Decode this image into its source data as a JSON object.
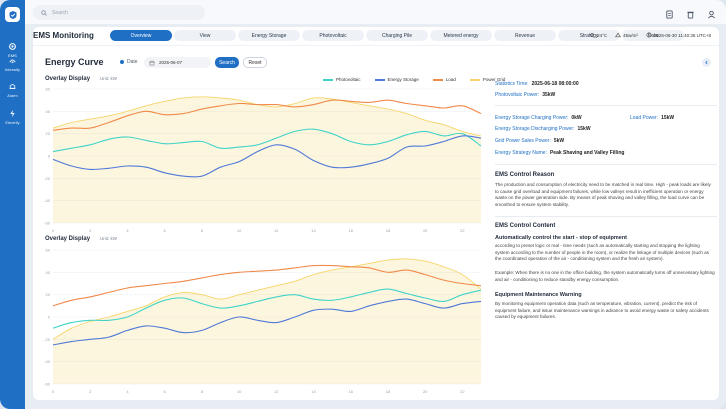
{
  "sidebar": {
    "items": [
      {
        "label": "EMS",
        "icon": "gear-icon"
      },
      {
        "label": "Intensity",
        "icon": "signal-icon"
      },
      {
        "label": "Alarm",
        "icon": "bell-icon"
      },
      {
        "label": "Electrify",
        "icon": "bolt-icon"
      }
    ]
  },
  "topbar": {
    "search_placeholder": "Search",
    "icons": [
      "document-icon",
      "trash-icon",
      "user-icon"
    ]
  },
  "header": {
    "title": "EMS Monitoring",
    "tabs": [
      {
        "label": "Overview",
        "active": true
      },
      {
        "label": "View",
        "active": false
      },
      {
        "label": "Energy Storage",
        "active": false
      },
      {
        "label": "Photovoltaic",
        "active": false
      },
      {
        "label": "Charging Pile",
        "active": false
      },
      {
        "label": "Metered energy",
        "active": false
      },
      {
        "label": "Revenue",
        "active": false
      },
      {
        "label": "Strategy",
        "active": false
      },
      {
        "label": "Data",
        "active": false
      }
    ],
    "status": {
      "temperature": "24°C",
      "power": "45w/m²",
      "datetime": "2025-06-30 11:40:35 UTC+8"
    }
  },
  "toolbar": {
    "section_title": "Energy Curve",
    "date_label": "Date",
    "date_value": "2025-06-07",
    "search_label": "Search",
    "reset_label": "Reset"
  },
  "legend": [
    {
      "name": "Photovoltaic",
      "color": "#3fd3c8"
    },
    {
      "name": "Energy Storage",
      "color": "#4f79d8"
    },
    {
      "name": "Load",
      "color": "#f08a4b"
    },
    {
      "name": "Power Grid",
      "color": "#f5d56b"
    }
  ],
  "chart_data": [
    {
      "type": "line",
      "title": "Overlay Display",
      "unit_label": "Unit: kW",
      "x": [
        "0",
        "1",
        "2",
        "3",
        "4",
        "5",
        "6",
        "7",
        "8",
        "9",
        "10",
        "11",
        "12",
        "13",
        "14",
        "15",
        "16",
        "17",
        "18",
        "19",
        "20",
        "21",
        "22",
        "23"
      ],
      "ylim": [
        -60,
        60
      ],
      "yticks": [
        60,
        40,
        20,
        0,
        -20,
        -40,
        -60
      ],
      "series": [
        {
          "name": "Power Grid",
          "type": "area",
          "values": [
            25,
            30,
            33,
            36,
            40,
            45,
            49,
            52,
            53,
            52,
            50,
            46,
            44,
            47,
            52,
            51,
            48,
            45,
            42,
            38,
            32,
            28,
            22,
            18
          ]
        },
        {
          "name": "Load",
          "values": [
            23,
            25,
            25,
            30,
            36,
            40,
            37,
            38,
            42,
            45,
            47,
            46,
            46,
            44,
            46,
            50,
            49,
            48,
            50,
            47,
            45,
            43,
            45,
            38
          ]
        },
        {
          "name": "Photovoltaic",
          "values": [
            4,
            7,
            10,
            15,
            17,
            14,
            11,
            12,
            13,
            7,
            8,
            10,
            16,
            22,
            24,
            20,
            13,
            10,
            13,
            19,
            22,
            18,
            20,
            9
          ]
        },
        {
          "name": "Energy Storage",
          "values": [
            -3,
            -9,
            -12,
            -11,
            -9,
            -10,
            -15,
            -18,
            -18,
            -10,
            -5,
            4,
            10,
            6,
            -4,
            -10,
            -10,
            -7,
            -2,
            8,
            9,
            13,
            18,
            16
          ]
        }
      ]
    },
    {
      "type": "line",
      "title": "Overlay Display",
      "unit_label": "Unit: kW",
      "x": [
        "0",
        "1",
        "2",
        "3",
        "4",
        "5",
        "6",
        "7",
        "8",
        "9",
        "10",
        "11",
        "12",
        "13",
        "14",
        "15",
        "16",
        "17",
        "18",
        "19",
        "20",
        "21",
        "22",
        "23"
      ],
      "ylim": [
        -60,
        60
      ],
      "yticks": [
        60,
        40,
        20,
        0,
        -20,
        -40,
        -60
      ],
      "series": [
        {
          "name": "Power Grid",
          "type": "area",
          "values": [
            -20,
            -10,
            -4,
            0,
            5,
            10,
            18,
            22,
            20,
            16,
            20,
            24,
            28,
            32,
            38,
            42,
            45,
            48,
            51,
            52,
            50,
            45,
            38,
            25
          ]
        },
        {
          "name": "Load",
          "values": [
            10,
            15,
            18,
            22,
            26,
            28,
            30,
            32,
            35,
            38,
            40,
            41,
            42,
            44,
            46,
            46,
            45,
            44,
            40,
            42,
            38,
            33,
            30,
            28
          ]
        },
        {
          "name": "Photovoltaic",
          "values": [
            -10,
            -5,
            -3,
            -3,
            0,
            8,
            15,
            17,
            12,
            8,
            10,
            14,
            18,
            20,
            16,
            15,
            18,
            22,
            25,
            21,
            17,
            14,
            20,
            24
          ]
        },
        {
          "name": "Energy Storage",
          "values": [
            -25,
            -22,
            -20,
            -18,
            -12,
            -8,
            -10,
            -14,
            -12,
            -5,
            0,
            -3,
            -5,
            0,
            6,
            7,
            5,
            10,
            14,
            16,
            12,
            8,
            12,
            14
          ]
        }
      ]
    }
  ],
  "panel": {
    "stats_time_label": "Statistics Time:",
    "stats_time_value": "2025-06-18 08:00:00",
    "pv_power_label": "Photovoltaic Power:",
    "pv_power_value": "35kW",
    "es_charge_label": "Energy Storage Charging Power:",
    "es_charge_value": "0kW",
    "load_power_label": "Load Power:",
    "load_power_value": "15kW",
    "es_discharge_label": "Energy Storage Discharging Power:",
    "es_discharge_value": "15kW",
    "grid_sales_label": "Grid Power Sales Power:",
    "grid_sales_value": "5kW",
    "strategy_label": "Energy Strategy Name:",
    "strategy_value": "Peak Shaving and Valley Filling",
    "reason_title": "EMS Control Reason",
    "reason_text": "The production and consumption of electricity need to be matched in real time. High - peak loads are likely to cause grid overload and equipment failures, while low valleys result in inefficient operation or energy waste on the power generation side. By means of peak shaving and valley filling, the load curve can be smoothed to ensure system stability.",
    "content_title": "EMS Control Content",
    "auto_title": "Automatically control the start - stop of equipment",
    "auto_text": "according to preset logic or real - time needs (such as automatically starting and stopping the lighting system according to the number of people in the room), or realize the linkage of multiple devices (such as the coordinated operation of the air - conditioning system and the fresh air system).",
    "example_text": "Example: When there is no one in the office building, the system automatically turns off unnecessary lighting and air - conditioning to reduce standby energy consumption.",
    "maint_title": "Equipment Maintenance Warning",
    "maint_text": "By monitoring equipment operation data (such as temperature, vibration, current), predict the risk of equipment failure, and issue maintenance warnings in advance to avoid energy waste or safety accidents caused by equipment failures."
  }
}
